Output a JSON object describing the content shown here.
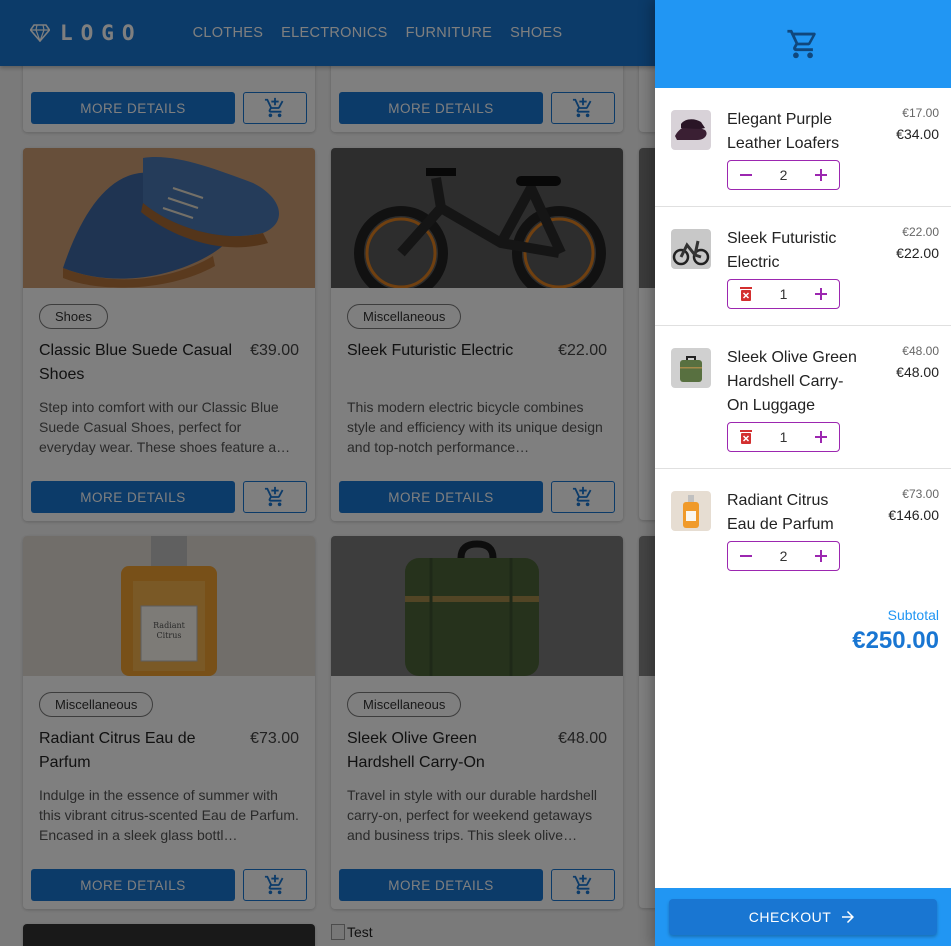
{
  "header": {
    "logo_text": "LOGO",
    "nav": [
      "CLOTHES",
      "ELECTRONICS",
      "FURNITURE",
      "SHOES"
    ]
  },
  "colors": {
    "primary": "#1976d2",
    "drawer_header": "#2196f3",
    "quantity_outline": "#9c27b0",
    "delete_icon": "#d32f2f"
  },
  "products": {
    "more_details_label": "MORE DETAILS",
    "row1": [
      {
        "category": "Shoes",
        "title": "Classic Blue Suede Casual Shoes",
        "price": "€39.00",
        "description": "Step into comfort with our Classic Blue Suede Casual Shoes, perfect for everyday wear. These shoes feature a…"
      },
      {
        "category": "Miscellaneous",
        "title": "Sleek Futuristic Electric",
        "price": "€22.00",
        "description": "This modern electric bicycle combines style and efficiency with its unique design and top-notch performance…"
      }
    ],
    "row2": [
      {
        "category": "Miscellaneous",
        "title": "Radiant Citrus Eau de Parfum",
        "price": "€73.00",
        "description": "Indulge in the essence of summer with this vibrant citrus-scented Eau de Parfum. Encased in a sleek glass bottl…"
      },
      {
        "category": "Miscellaneous",
        "title": "Sleek Olive Green Hardshell Carry-On Luggage",
        "price": "€48.00",
        "description": "Travel in style with our durable hardshell carry-on, perfect for weekend getaways and business trips. This sleek olive…"
      }
    ],
    "broken_image_alt": "Test"
  },
  "cart": {
    "items": [
      {
        "name": "Elegant Purple Leather Loafers",
        "unit_price": "€17.00",
        "total": "€34.00",
        "quantity": "2",
        "thumb": "shoe"
      },
      {
        "name": "Sleek Futuristic Electric",
        "unit_price": "€22.00",
        "total": "€22.00",
        "quantity": "1",
        "thumb": "bike"
      },
      {
        "name": "Sleek Olive Green Hardshell Carry-On Luggage",
        "unit_price": "€48.00",
        "total": "€48.00",
        "quantity": "1",
        "thumb": "luggage"
      },
      {
        "name": "Radiant Citrus Eau de Parfum",
        "unit_price": "€73.00",
        "total": "€146.00",
        "quantity": "2",
        "thumb": "perfume"
      }
    ],
    "subtotal_label": "Subtotal",
    "subtotal_value": "€250.00",
    "checkout_label": "CHECKOUT"
  }
}
